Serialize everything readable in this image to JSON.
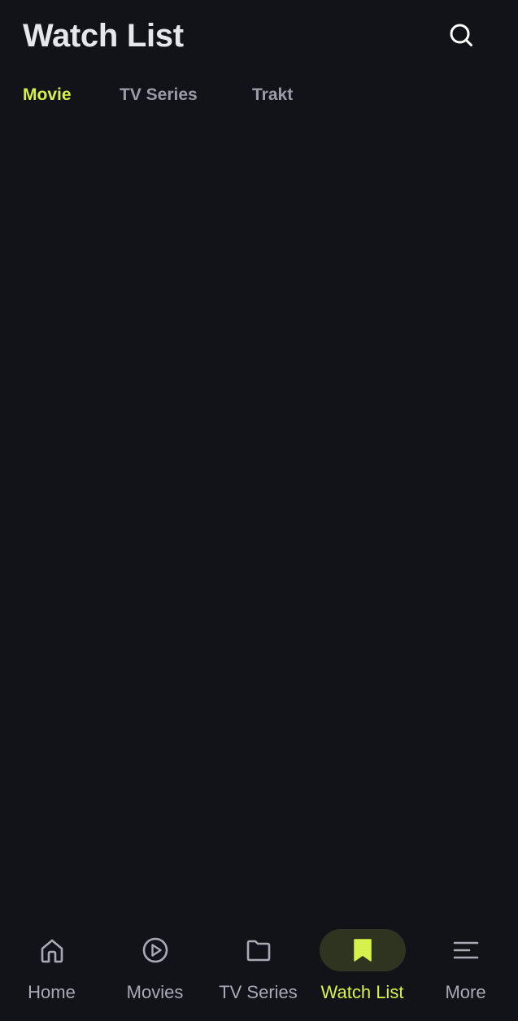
{
  "header": {
    "title": "Watch List",
    "search_icon": "search-icon"
  },
  "tabs": [
    {
      "label": "Movie",
      "active": true
    },
    {
      "label": "TV Series",
      "active": false
    },
    {
      "label": "Trakt",
      "active": false
    }
  ],
  "bottom_nav": [
    {
      "label": "Home",
      "icon": "home-icon",
      "active": false
    },
    {
      "label": "Movies",
      "icon": "play-circle-icon",
      "active": false
    },
    {
      "label": "TV Series",
      "icon": "folder-icon",
      "active": false
    },
    {
      "label": "Watch List",
      "icon": "bookmark-icon",
      "active": true
    },
    {
      "label": "More",
      "icon": "menu-icon",
      "active": false
    }
  ],
  "colors": {
    "background": "#121319",
    "accent": "#d6f24a",
    "inactive_text": "#9a9ca6",
    "active_pill": "#2f3420"
  }
}
